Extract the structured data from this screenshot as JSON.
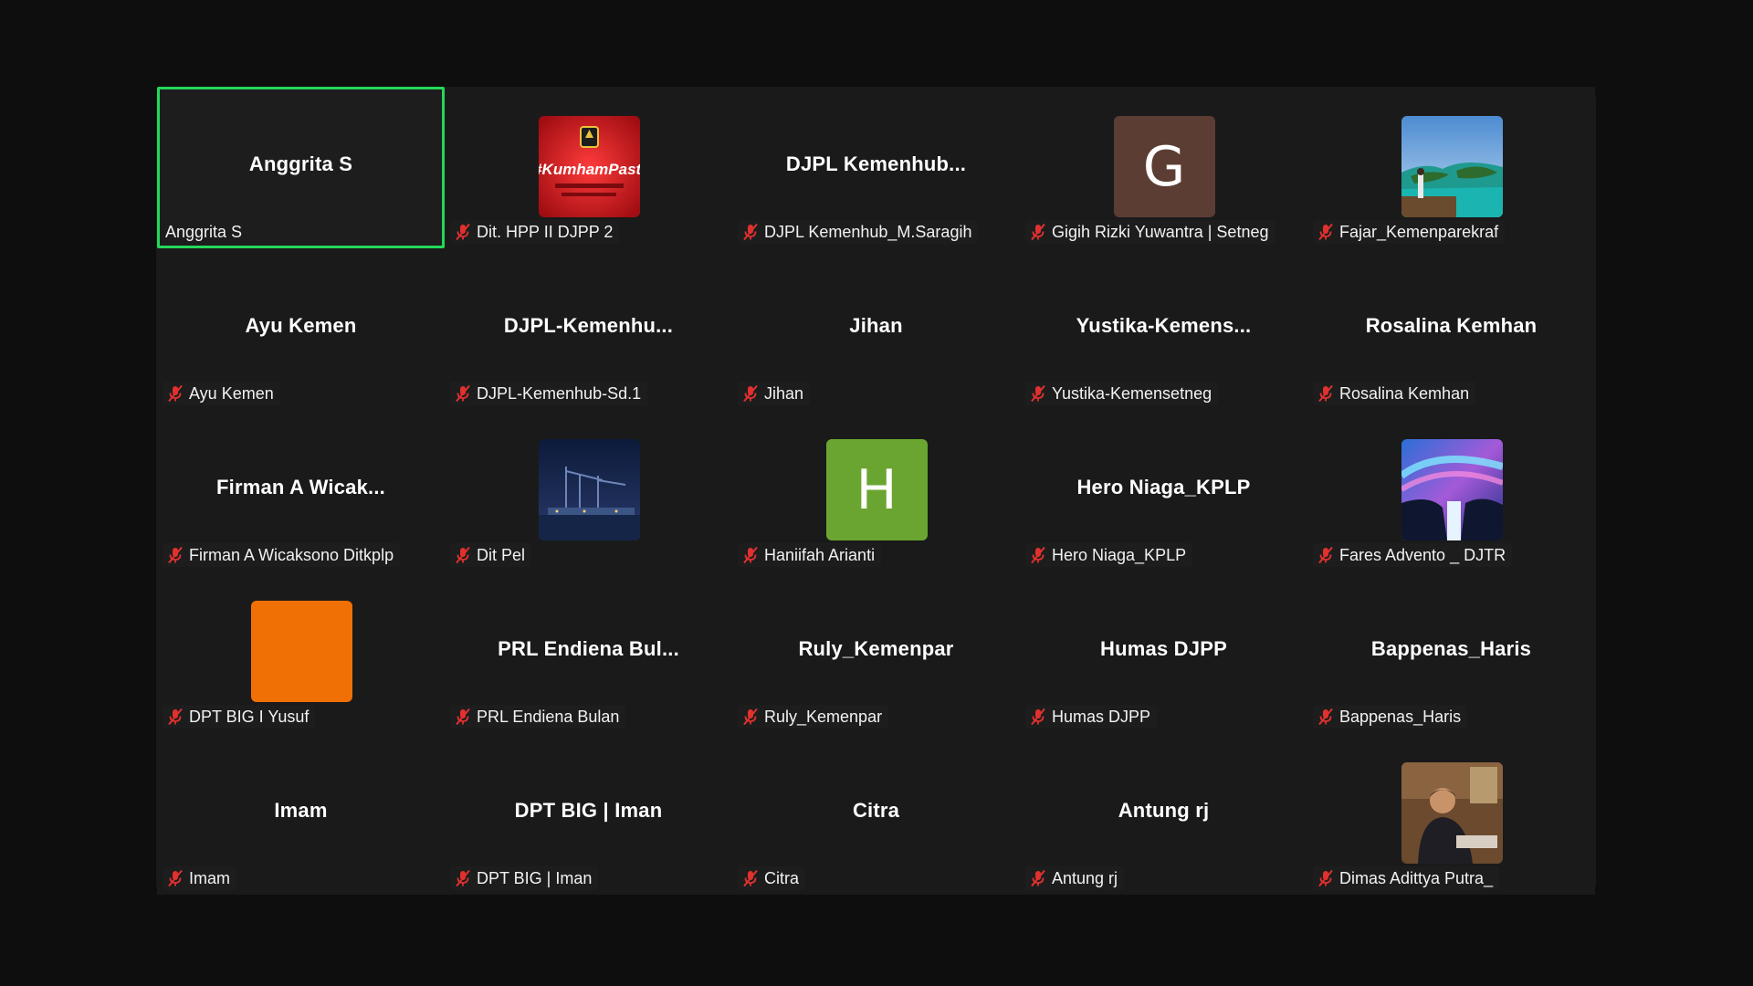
{
  "participants": [
    {
      "display": "Anggrita S",
      "tag": "Anggrita S",
      "active": true,
      "muted": false,
      "avatar": null
    },
    {
      "display": "",
      "tag": "Dit. HPP II DJPP 2",
      "muted": true,
      "avatar": "kumham-image",
      "avatar_text": "#KumhamPasti"
    },
    {
      "display": "DJPL  Kemenhub...",
      "tag": "DJPL Kemenhub_M.Saragih",
      "muted": true,
      "avatar": null
    },
    {
      "display": "",
      "tag": "Gigih Rizki Yuwantra | Setneg",
      "muted": true,
      "avatar": "letter",
      "letter": "G",
      "avatar_color": "#5c3d34"
    },
    {
      "display": "",
      "tag": "Fajar_Kemenparekraf",
      "muted": true,
      "avatar": "island-photo"
    },
    {
      "display": "Ayu Kemen",
      "tag": "Ayu Kemen",
      "muted": true,
      "avatar": null
    },
    {
      "display": "DJPL-Kemenhu...",
      "tag": "DJPL-Kemenhub-Sd.1",
      "muted": true,
      "avatar": null
    },
    {
      "display": "Jihan",
      "tag": "Jihan",
      "muted": true,
      "avatar": null
    },
    {
      "display": "Yustika-Kemens...",
      "tag": "Yustika-Kemensetneg",
      "muted": true,
      "avatar": null
    },
    {
      "display": "Rosalina Kemhan",
      "tag": "Rosalina Kemhan",
      "muted": true,
      "avatar": null
    },
    {
      "display": "Firman  A  Wicak...",
      "tag": "Firman A Wicaksono Ditkplp",
      "muted": true,
      "avatar": null
    },
    {
      "display": "",
      "tag": "Dit Pel",
      "muted": true,
      "avatar": "port-photo"
    },
    {
      "display": "",
      "tag": "Haniifah Arianti",
      "muted": true,
      "avatar": "letter",
      "letter": "H",
      "avatar_color": "#6aa531"
    },
    {
      "display": "Hero Niaga_KPLP",
      "tag": "Hero Niaga_KPLP",
      "muted": true,
      "avatar": null
    },
    {
      "display": "",
      "tag": "Fares Advento _ DJTR",
      "muted": true,
      "avatar": "aurora-photo"
    },
    {
      "display": "",
      "tag": "DPT BIG I Yusuf",
      "muted": true,
      "avatar": "solid",
      "avatar_color": "#f07006"
    },
    {
      "display": "PRL  Endiena  Bul...",
      "tag": "PRL Endiena Bulan",
      "muted": true,
      "avatar": null
    },
    {
      "display": "Ruly_Kemenpar",
      "tag": "Ruly_Kemenpar",
      "muted": true,
      "avatar": null
    },
    {
      "display": "Humas DJPP",
      "tag": "Humas DJPP",
      "muted": true,
      "avatar": null
    },
    {
      "display": "Bappenas_Haris",
      "tag": "Bappenas_Haris",
      "muted": true,
      "avatar": null
    },
    {
      "display": "Imam",
      "tag": "Imam",
      "muted": true,
      "avatar": null
    },
    {
      "display": "DPT BIG | Iman",
      "tag": "DPT BIG | Iman",
      "muted": true,
      "avatar": null
    },
    {
      "display": "Citra",
      "tag": "Citra",
      "muted": true,
      "avatar": null
    },
    {
      "display": "Antung rj",
      "tag": "Antung rj",
      "muted": true,
      "avatar": null
    },
    {
      "display": "",
      "tag": "Dimas Adittya Putra_",
      "muted": true,
      "avatar": "person-photo"
    }
  ],
  "colors": {
    "active_border": "#23d959",
    "mute_icon": "#e0312f",
    "background": "#0e0e0e",
    "tile": "#1a1a1a"
  }
}
